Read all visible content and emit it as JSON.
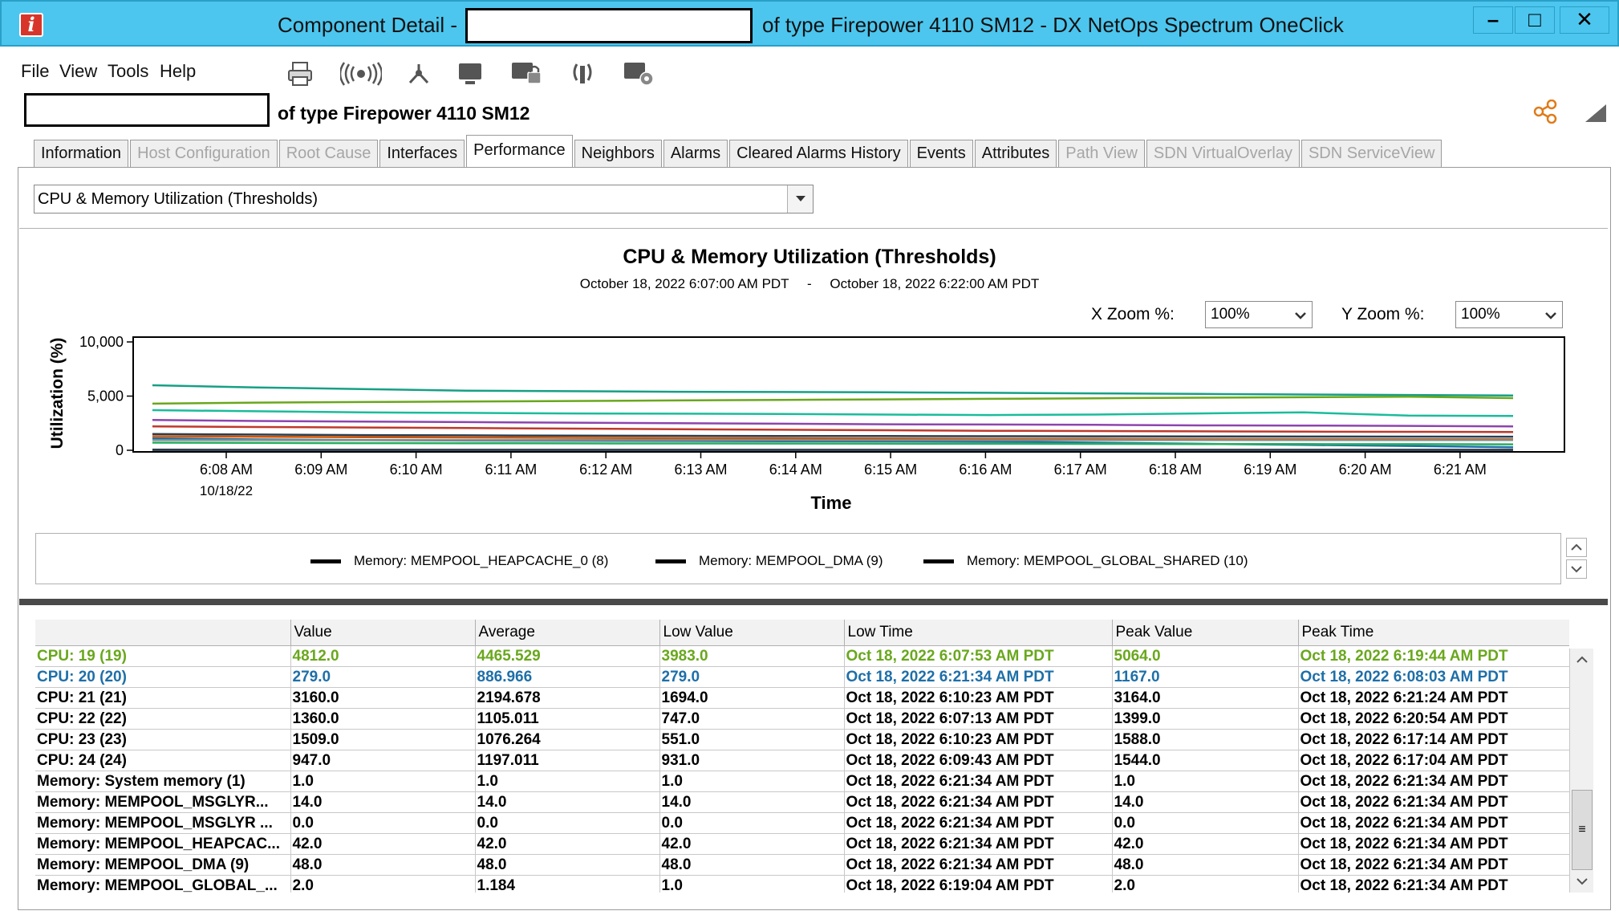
{
  "window": {
    "title_prefix": "Component Detail -",
    "title_suffix": "of type Firepower 4110 SM12 - DX NetOps Spectrum OneClick",
    "app_icon_glyph": "i",
    "minimize": "–",
    "maximize": "□",
    "close": "✕"
  },
  "menu": {
    "file": "File",
    "view": "View",
    "tools": "Tools",
    "help": "Help"
  },
  "toolbar_icons": [
    "print-icon",
    "signal-icon",
    "topology-icon",
    "monitor-icon",
    "lock-screen-icon",
    "alarm-broadcast-icon",
    "device-settings-icon"
  ],
  "model": {
    "type_label": "of type Firepower 4110 SM12"
  },
  "tabs": [
    {
      "label": "Information",
      "state": "normal"
    },
    {
      "label": "Host Configuration",
      "state": "disabled"
    },
    {
      "label": "Root Cause",
      "state": "disabled"
    },
    {
      "label": "Interfaces",
      "state": "normal"
    },
    {
      "label": "Performance",
      "state": "active"
    },
    {
      "label": "Neighbors",
      "state": "normal"
    },
    {
      "label": "Alarms",
      "state": "normal"
    },
    {
      "label": "Cleared Alarms History",
      "state": "normal"
    },
    {
      "label": "Events",
      "state": "normal"
    },
    {
      "label": "Attributes",
      "state": "normal"
    },
    {
      "label": "Path View",
      "state": "disabled"
    },
    {
      "label": "SDN VirtualOverlay",
      "state": "disabled"
    },
    {
      "label": "SDN ServiceView",
      "state": "disabled"
    }
  ],
  "view_selector": {
    "value": "CPU & Memory Utilization (Thresholds)"
  },
  "zoom": {
    "x_label": "X Zoom %:",
    "x_value": "100%",
    "y_label": "Y Zoom %:",
    "y_value": "100%"
  },
  "chart_data": {
    "type": "line",
    "title": "CPU & Memory Utilization (Thresholds)",
    "subtitle_start": "October 18, 2022 6:07:00 AM PDT",
    "subtitle_sep": "-",
    "subtitle_end": "October 18, 2022 6:22:00 AM PDT",
    "xlabel": "Time",
    "ylabel": "Utilization (%)",
    "ylim": [
      0,
      10000
    ],
    "yticks": [
      "0",
      "5,000",
      "10,000"
    ],
    "x": [
      "6:08 AM",
      "6:09 AM",
      "6:10 AM",
      "6:11 AM",
      "6:12 AM",
      "6:13 AM",
      "6:14 AM",
      "6:15 AM",
      "6:16 AM",
      "6:17 AM",
      "6:18 AM",
      "6:19 AM",
      "6:20 AM",
      "6:21 AM"
    ],
    "x_date_label": "10/18/22",
    "grid": false,
    "series": [
      {
        "color": "#16a085",
        "values": [
          6000,
          5800,
          5650,
          5500,
          5450,
          5400,
          5380,
          5350,
          5300,
          5250,
          5200,
          5150,
          5100,
          5050
        ]
      },
      {
        "color": "#6aa71d",
        "values": [
          4300,
          4400,
          4450,
          4500,
          4550,
          4600,
          4650,
          4700,
          4750,
          4800,
          4850,
          4900,
          4950,
          4812
        ]
      },
      {
        "color": "#1abc9c",
        "values": [
          3700,
          3600,
          3500,
          3450,
          3400,
          3380,
          3350,
          3300,
          3250,
          3300,
          3400,
          3500,
          3200,
          3160
        ]
      },
      {
        "color": "#1e6fa8",
        "values": [
          1100,
          1000,
          950,
          900,
          880,
          860,
          840,
          820,
          800,
          700,
          600,
          500,
          400,
          279
        ]
      },
      {
        "color": "#8e44ad",
        "values": [
          2800,
          2700,
          2650,
          2600,
          2550,
          2500,
          2450,
          2400,
          2380,
          2350,
          2300,
          2280,
          2250,
          2200
        ]
      },
      {
        "color": "#c0392b",
        "values": [
          2200,
          2150,
          2100,
          2050,
          2000,
          1950,
          1900,
          1850,
          1800,
          1780,
          1750,
          1720,
          1700,
          1680
        ]
      },
      {
        "color": "#2c3e50",
        "values": [
          1500,
          1450,
          1400,
          1380,
          1350,
          1330,
          1320,
          1310,
          1300,
          1290,
          1280,
          1270,
          1260,
          1250
        ]
      },
      {
        "color": "#d35400",
        "values": [
          1300,
          1250,
          1200,
          1180,
          1150,
          1120,
          1100,
          1080,
          1060,
          1050,
          1040,
          1030,
          1020,
          1010
        ]
      },
      {
        "color": "#7f8c8d",
        "values": [
          950,
          940,
          930,
          935,
          945,
          950,
          940,
          935,
          930,
          940,
          945,
          947,
          950,
          947
        ]
      },
      {
        "color": "#27ae60",
        "values": [
          700,
          680,
          660,
          650,
          640,
          630,
          620,
          610,
          600,
          590,
          580,
          570,
          560,
          551
        ]
      },
      {
        "color": "#000000",
        "values": [
          50,
          48,
          48,
          48,
          48,
          48,
          48,
          48,
          48,
          48,
          48,
          48,
          48,
          48
        ]
      },
      {
        "color": "#34495e",
        "values": [
          15,
          14,
          14,
          14,
          14,
          14,
          14,
          14,
          14,
          14,
          14,
          14,
          14,
          14
        ]
      }
    ]
  },
  "legend": [
    {
      "name": "Memory: MEMPOOL_HEAPCACHE_0 (8)",
      "color": "#000000"
    },
    {
      "name": "Memory: MEMPOOL_DMA (9)",
      "color": "#000000"
    },
    {
      "name": "Memory: MEMPOOL_GLOBAL_SHARED (10)",
      "color": "#000000"
    }
  ],
  "table": {
    "columns": [
      "",
      "Value",
      "Average",
      "Low Value",
      "Low Time",
      "Peak Value",
      "Peak Time"
    ],
    "rows": [
      {
        "style": "green",
        "cells": [
          "CPU: 19 (19)",
          "4812.0",
          "4465.529",
          "3983.0",
          "Oct 18, 2022 6:07:53 AM PDT",
          "5064.0",
          "Oct 18, 2022 6:19:44 AM PDT"
        ]
      },
      {
        "style": "blue",
        "cells": [
          "CPU: 20 (20)",
          "279.0",
          "886.966",
          "279.0",
          "Oct 18, 2022 6:21:34 AM PDT",
          "1167.0",
          "Oct 18, 2022 6:08:03 AM PDT"
        ]
      },
      {
        "style": "black",
        "cells": [
          "CPU: 21 (21)",
          "3160.0",
          "2194.678",
          "1694.0",
          "Oct 18, 2022 6:10:23 AM PDT",
          "3164.0",
          "Oct 18, 2022 6:21:24 AM PDT"
        ]
      },
      {
        "style": "black",
        "cells": [
          "CPU: 22 (22)",
          "1360.0",
          "1105.011",
          "747.0",
          "Oct 18, 2022 6:07:13 AM PDT",
          "1399.0",
          "Oct 18, 2022 6:20:54 AM PDT"
        ]
      },
      {
        "style": "black",
        "cells": [
          "CPU: 23 (23)",
          "1509.0",
          "1076.264",
          "551.0",
          "Oct 18, 2022 6:10:23 AM PDT",
          "1588.0",
          "Oct 18, 2022 6:17:14 AM PDT"
        ]
      },
      {
        "style": "black",
        "cells": [
          "CPU: 24 (24)",
          "947.0",
          "1197.011",
          "931.0",
          "Oct 18, 2022 6:09:43 AM PDT",
          "1544.0",
          "Oct 18, 2022 6:17:04 AM PDT"
        ]
      },
      {
        "style": "black",
        "cells": [
          "Memory: System memory (1)",
          "1.0",
          "1.0",
          "1.0",
          "Oct 18, 2022 6:21:34 AM PDT",
          "1.0",
          "Oct 18, 2022 6:21:34 AM PDT"
        ]
      },
      {
        "style": "black",
        "cells": [
          "Memory: MEMPOOL_MSGLYR...",
          "14.0",
          "14.0",
          "14.0",
          "Oct 18, 2022 6:21:34 AM PDT",
          "14.0",
          "Oct 18, 2022 6:21:34 AM PDT"
        ]
      },
      {
        "style": "black",
        "cells": [
          "Memory: MEMPOOL_MSGLYR ...",
          "0.0",
          "0.0",
          "0.0",
          "Oct 18, 2022 6:21:34 AM PDT",
          "0.0",
          "Oct 18, 2022 6:21:34 AM PDT"
        ]
      },
      {
        "style": "black",
        "cells": [
          "Memory: MEMPOOL_HEAPCAC...",
          "42.0",
          "42.0",
          "42.0",
          "Oct 18, 2022 6:21:34 AM PDT",
          "42.0",
          "Oct 18, 2022 6:21:34 AM PDT"
        ]
      },
      {
        "style": "black",
        "cells": [
          "Memory: MEMPOOL_DMA (9)",
          "48.0",
          "48.0",
          "48.0",
          "Oct 18, 2022 6:21:34 AM PDT",
          "48.0",
          "Oct 18, 2022 6:21:34 AM PDT"
        ]
      },
      {
        "style": "black",
        "cells": [
          "Memory: MEMPOOL_GLOBAL_...",
          "2.0",
          "1.184",
          "1.0",
          "Oct 18, 2022 6:19:04 AM PDT",
          "2.0",
          "Oct 18, 2022 6:21:34 AM PDT"
        ]
      }
    ]
  }
}
